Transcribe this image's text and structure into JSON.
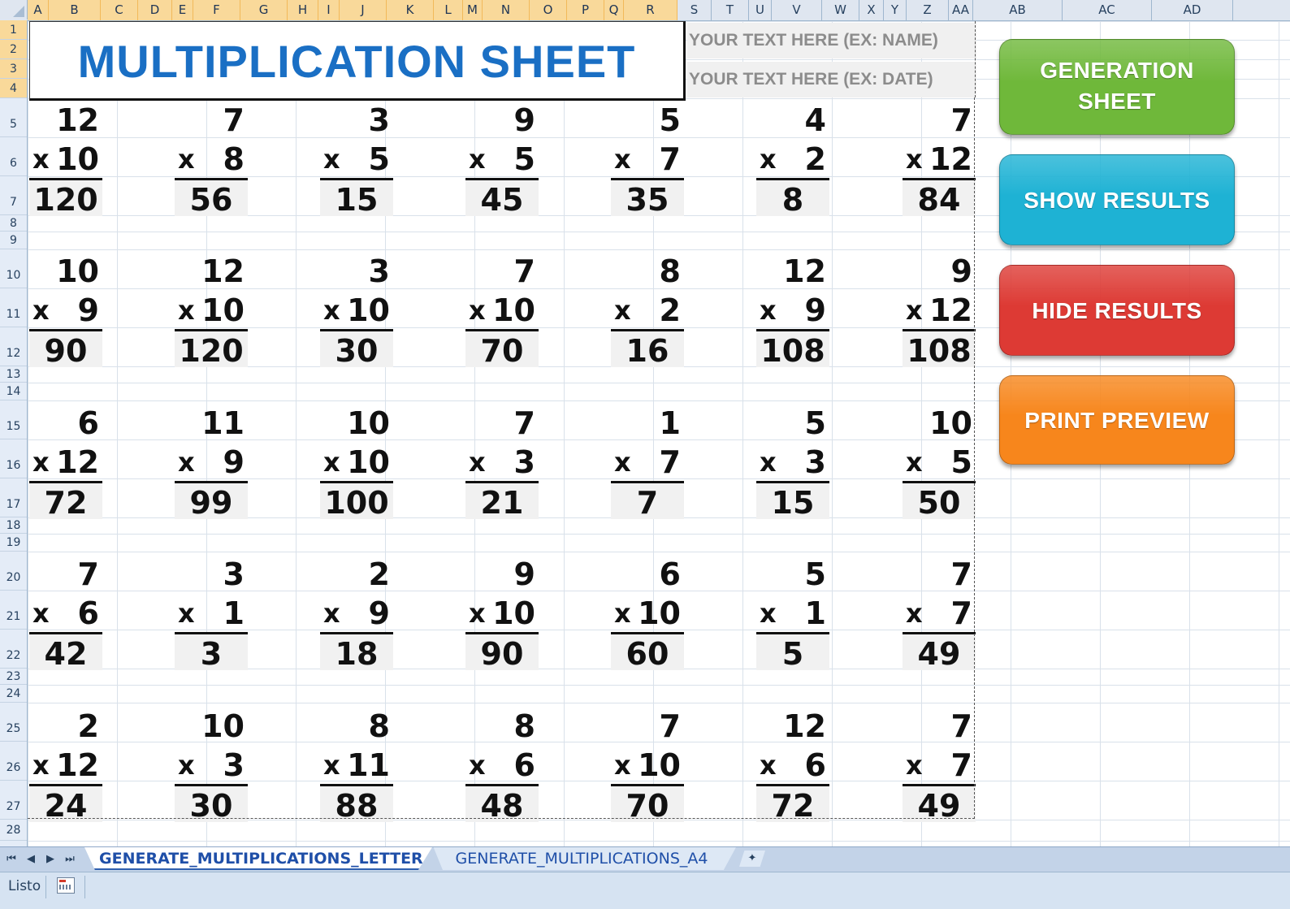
{
  "columns": [
    "A",
    "B",
    "C",
    "D",
    "E",
    "F",
    "G",
    "H",
    "I",
    "J",
    "K",
    "L",
    "M",
    "N",
    "O",
    "P",
    "Q",
    "R",
    "S",
    "T",
    "U",
    "V",
    "W",
    "X",
    "Y",
    "Z",
    "AA",
    "AB",
    "AC",
    "AD"
  ],
  "rows": [
    "1",
    "2",
    "3",
    "4",
    "5",
    "6",
    "7",
    "8",
    "9",
    "10",
    "11",
    "12",
    "13",
    "14",
    "15",
    "16",
    "17",
    "18",
    "19",
    "20",
    "21",
    "22",
    "23",
    "24",
    "25",
    "26",
    "27",
    "28"
  ],
  "title": "MULTIPLICATION SHEET",
  "name_cell": "YOUR TEXT HERE (EX: NAME)",
  "date_cell": "YOUR TEXT HERE (EX: DATE)",
  "operator": "x",
  "problems": [
    [
      {
        "a": "12",
        "b": "10",
        "r": "120"
      },
      {
        "a": "7",
        "b": "8",
        "r": "56"
      },
      {
        "a": "3",
        "b": "5",
        "r": "15"
      },
      {
        "a": "9",
        "b": "5",
        "r": "45"
      },
      {
        "a": "5",
        "b": "7",
        "r": "35"
      },
      {
        "a": "4",
        "b": "2",
        "r": "8"
      },
      {
        "a": "7",
        "b": "12",
        "r": "84"
      }
    ],
    [
      {
        "a": "10",
        "b": "9",
        "r": "90"
      },
      {
        "a": "12",
        "b": "10",
        "r": "120"
      },
      {
        "a": "3",
        "b": "10",
        "r": "30"
      },
      {
        "a": "7",
        "b": "10",
        "r": "70"
      },
      {
        "a": "8",
        "b": "2",
        "r": "16"
      },
      {
        "a": "12",
        "b": "9",
        "r": "108"
      },
      {
        "a": "9",
        "b": "12",
        "r": "108"
      }
    ],
    [
      {
        "a": "6",
        "b": "12",
        "r": "72"
      },
      {
        "a": "11",
        "b": "9",
        "r": "99"
      },
      {
        "a": "10",
        "b": "10",
        "r": "100"
      },
      {
        "a": "7",
        "b": "3",
        "r": "21"
      },
      {
        "a": "1",
        "b": "7",
        "r": "7"
      },
      {
        "a": "5",
        "b": "3",
        "r": "15"
      },
      {
        "a": "10",
        "b": "5",
        "r": "50"
      }
    ],
    [
      {
        "a": "7",
        "b": "6",
        "r": "42"
      },
      {
        "a": "3",
        "b": "1",
        "r": "3"
      },
      {
        "a": "2",
        "b": "9",
        "r": "18"
      },
      {
        "a": "9",
        "b": "10",
        "r": "90"
      },
      {
        "a": "6",
        "b": "10",
        "r": "60"
      },
      {
        "a": "5",
        "b": "1",
        "r": "5"
      },
      {
        "a": "7",
        "b": "7",
        "r": "49"
      }
    ],
    [
      {
        "a": "2",
        "b": "12",
        "r": "24"
      },
      {
        "a": "10",
        "b": "3",
        "r": "30"
      },
      {
        "a": "8",
        "b": "11",
        "r": "88"
      },
      {
        "a": "8",
        "b": "6",
        "r": "48"
      },
      {
        "a": "7",
        "b": "10",
        "r": "70"
      },
      {
        "a": "12",
        "b": "6",
        "r": "72"
      },
      {
        "a": "7",
        "b": "7",
        "r": "49"
      }
    ]
  ],
  "buttons": {
    "generation": [
      "GENERATION",
      "SHEET"
    ],
    "show": "SHOW RESULTS",
    "hide": "HIDE RESULTS",
    "print": "PRINT PREVIEW"
  },
  "button_colors": {
    "generation": "#6fb83a",
    "show": "#1eb2d4",
    "hide": "#dd3a34",
    "print": "#f7861c"
  },
  "sheet_tabs": [
    "GENERATE_MULTIPLICATIONS_LETTER",
    "GENERATE_MULTIPLICATIONS_A4"
  ],
  "nav_icons": [
    "first-sheet-icon",
    "prev-sheet-icon",
    "next-sheet-icon",
    "last-sheet-icon"
  ],
  "status": "Listo"
}
